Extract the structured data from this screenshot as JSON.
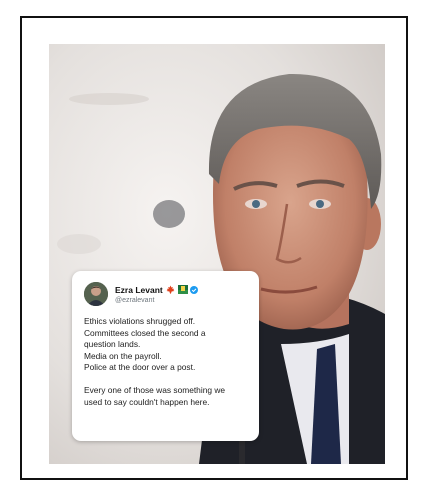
{
  "tweet": {
    "display_name": "Ezra Levant",
    "handle": "@ezralevant",
    "lines": [
      "Ethics violations shrugged off.",
      "Committees closed the second a",
      "question lands.",
      "Media on the payroll.",
      "Police at the door over a post.",
      "",
      "Every one of those was something we",
      "used to say couldn't happen here."
    ],
    "badges": [
      "maple-leaf-flag-icon",
      "alberta-flag-icon",
      "verified-badge-icon"
    ]
  },
  "colors": {
    "frame_border": "#111111",
    "verified_blue": "#1d9bf0",
    "name_text": "#111111",
    "handle_text": "#6e767d"
  }
}
